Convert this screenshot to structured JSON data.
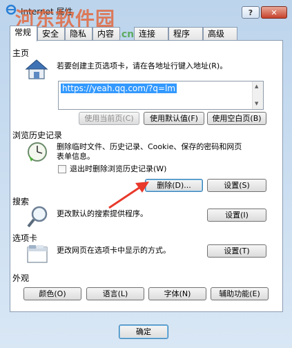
{
  "window": {
    "title": "Internet 属性",
    "help_label": "?",
    "close_label": "✕",
    "watermark": "河东软件园",
    "watermark_url": "www.pc0359.cn"
  },
  "tabs": [
    "常规",
    "安全",
    "隐私",
    "内容",
    "连接",
    "程序",
    "高级"
  ],
  "home": {
    "label": "主页",
    "description": "若要创建主页选项卡，请在各地址行键入地址(R)。",
    "url": "https://yeah.qq.com/?q=lm",
    "use_current": "使用当前页(C)",
    "use_default": "使用默认值(F)",
    "use_blank": "使用空白页(B)"
  },
  "history": {
    "label": "浏览历史记录",
    "description_line1": "删除临时文件、历史记录、Cookie、保存的密码和网页",
    "description_line2": "表单信息。",
    "checkbox_label": "退出时删除浏览历史记录(W)",
    "delete_button": "删除(D)...",
    "settings_button": "设置(S)"
  },
  "search": {
    "label": "搜索",
    "description": "更改默认的搜索提供程序。",
    "settings_button": "设置(I)"
  },
  "tabs_section": {
    "label": "选项卡",
    "description": "更改网页在选项卡中显示的方式。",
    "settings_button": "设置(T)"
  },
  "appearance": {
    "label": "外观",
    "colors": "颜色(O)",
    "languages": "语言(L)",
    "fonts": "字体(N)",
    "accessibility": "辅助功能(E)"
  },
  "footer": {
    "ok": "确定"
  },
  "colors": {
    "selection": "#3399ff",
    "arrow": "#e8392b",
    "watermark": "#e65a28"
  }
}
